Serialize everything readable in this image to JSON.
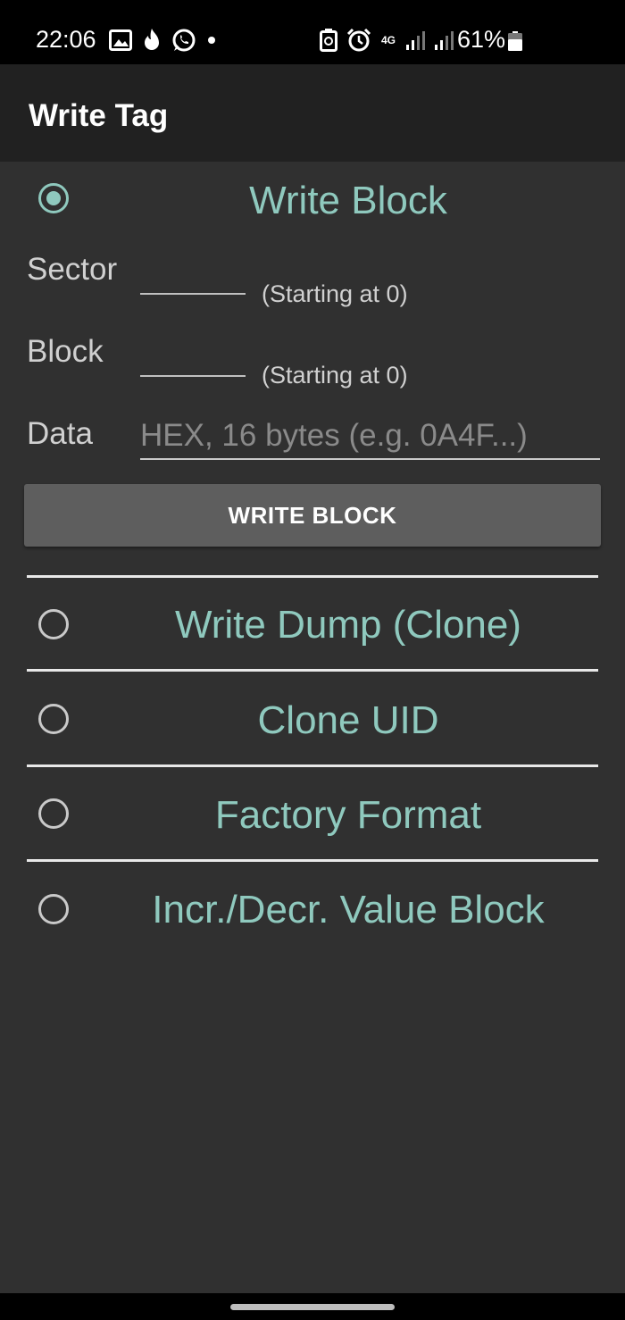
{
  "status_bar": {
    "time": "22:06",
    "network": "4G",
    "battery": "61%",
    "icons": [
      "gallery-icon",
      "fire-icon",
      "whatsapp-icon",
      "dot-icon",
      "battery-saver-icon",
      "alarm-icon",
      "signal-icon",
      "signal-icon-2",
      "battery-icon"
    ]
  },
  "app_bar": {
    "title": "Write Tag"
  },
  "options": [
    {
      "label": "Write Block",
      "selected": true
    },
    {
      "label": "Write Dump (Clone)",
      "selected": false
    },
    {
      "label": "Clone UID",
      "selected": false
    },
    {
      "label": "Factory Format",
      "selected": false
    },
    {
      "label": "Incr./Decr. Value Block",
      "selected": false
    }
  ],
  "write_block": {
    "sector_label": "Sector",
    "sector_hint": "(Starting at 0)",
    "block_label": "Block",
    "block_hint": "(Starting at 0)",
    "data_label": "Data",
    "data_placeholder": "HEX, 16 bytes (e.g. 0A4F...)",
    "button_label": "WRITE BLOCK"
  },
  "colors": {
    "accent": "#8fc9be",
    "background": "#303030",
    "app_bar": "#212121",
    "button": "#5e5e5e"
  }
}
